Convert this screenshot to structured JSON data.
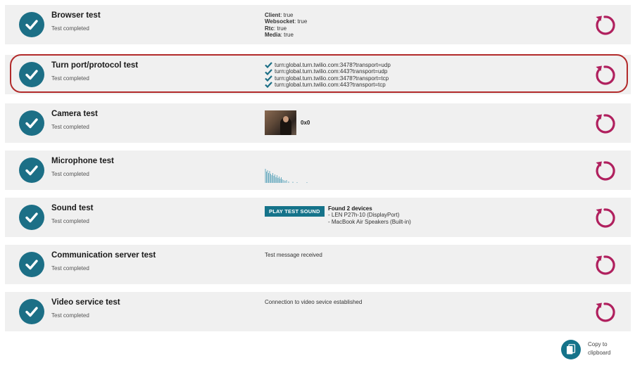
{
  "colors": {
    "accent": "#1c6f86",
    "retry": "#b0205e",
    "highlight": "#b22a2a",
    "row_bg": "#f0f0f0"
  },
  "icons": {
    "check": "check-circle-icon",
    "retry": "retry-icon",
    "copy": "copy-icon",
    "turn_ok": "checkmark-icon"
  },
  "tests": [
    {
      "title": "Browser test",
      "status": "Test completed"
    },
    {
      "title": "Turn port/protocol test",
      "status": "Test completed"
    },
    {
      "title": "Camera test",
      "status": "Test completed"
    },
    {
      "title": "Microphone test",
      "status": "Test completed"
    },
    {
      "title": "Sound test",
      "status": "Test completed"
    },
    {
      "title": "Communication server test",
      "status": "Test completed"
    },
    {
      "title": "Video service test",
      "status": "Test completed"
    }
  ],
  "browser": {
    "items": [
      {
        "key": "Client",
        "value": ": true"
      },
      {
        "key": "Websocket",
        "value": ": true"
      },
      {
        "key": "Rtc",
        "value": ": true"
      },
      {
        "key": "Media",
        "value": ": true"
      }
    ]
  },
  "turn": {
    "urls": [
      "turn:global.turn.twilio.com:3478?transport=udp",
      "turn:global.turn.twilio.com:443?transport=udp",
      "turn:global.turn.twilio.com:3478?transport=tcp",
      "turn:global.turn.twilio.com:443?transport=tcp"
    ]
  },
  "camera": {
    "resolution": "0x0"
  },
  "sound": {
    "play_label": "PLAY TEST SOUND",
    "found": "Found 2 devices",
    "devices": [
      "- LEN P27h-10 (DisplayPort)",
      "- MacBook Air Speakers (Built-in)"
    ]
  },
  "communication": {
    "message": "Test message received"
  },
  "video": {
    "message": "Connection to video sevice established"
  },
  "copy": {
    "label_line1": "Copy to",
    "label_line2": "clipboard"
  }
}
